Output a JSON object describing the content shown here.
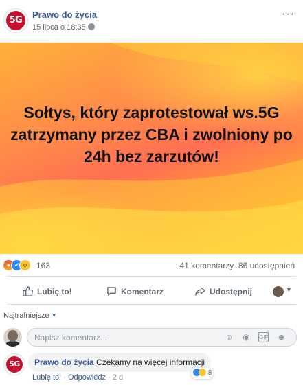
{
  "post": {
    "page_name": "Prawo do życia",
    "avatar_text": "5G",
    "date": "15 lipca o 18:35",
    "more_label": "···",
    "banner_text": "Sołtys, który zaprotestował ws.5G zatrzymany przez CBA i zwolniony po 24h bez zarzutów!"
  },
  "stats": {
    "reactions_count": "163",
    "comments": "41 komentarzy",
    "shares": "86 udostępnień",
    "reaction_icons": [
      "angry-icon",
      "like-icon",
      "wow-icon"
    ]
  },
  "actions": {
    "like_label": "Lubię to!",
    "comment_label": "Komentarz",
    "share_label": "Udostępnij"
  },
  "comments_section": {
    "sort_label": "Najtrafniejsze",
    "input_placeholder": "Napisz komentarz...",
    "input_icons": [
      "emoji-icon",
      "camera-icon",
      "gif-icon",
      "sticker-icon"
    ]
  },
  "comment": {
    "author": "Prawo do życia",
    "avatar_text": "5G",
    "text": "Czekamy na więcej informacji",
    "like_link": "Lubię to!",
    "reply_link": "Odpowiedz",
    "separator": "·",
    "age": "2 d",
    "reaction_count": "8"
  },
  "colors": {
    "link_blue": "#385898",
    "brand_red": "#c8102e",
    "like_blue": "#2d88ff"
  }
}
